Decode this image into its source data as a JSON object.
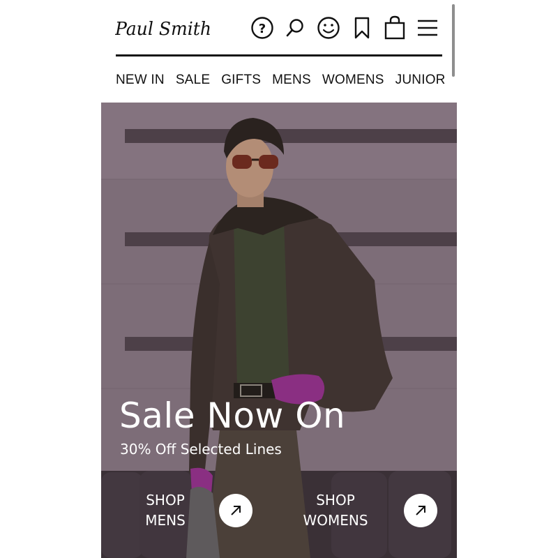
{
  "brand": {
    "logo_text": "Paul Smith"
  },
  "header": {
    "icons": [
      "help-icon",
      "search-icon",
      "account-icon",
      "wishlist-icon",
      "bag-icon",
      "menu-icon"
    ]
  },
  "nav": {
    "items": [
      {
        "label": "NEW IN"
      },
      {
        "label": "SALE"
      },
      {
        "label": "GIFTS"
      },
      {
        "label": "MENS"
      },
      {
        "label": "WOMENS"
      },
      {
        "label": "JUNIOR"
      }
    ]
  },
  "hero": {
    "title": "Sale Now On",
    "subtitle": "30% Off Selected Lines",
    "cta_mens": {
      "line1": "SHOP",
      "line2": "MENS"
    },
    "cta_womens": {
      "line1": "SHOP",
      "line2": "WOMENS"
    }
  },
  "colors": {
    "background_purple": "#7a6a75",
    "jacket": "#3f3330",
    "gloves": "#8a2f82",
    "text": "#111111"
  }
}
